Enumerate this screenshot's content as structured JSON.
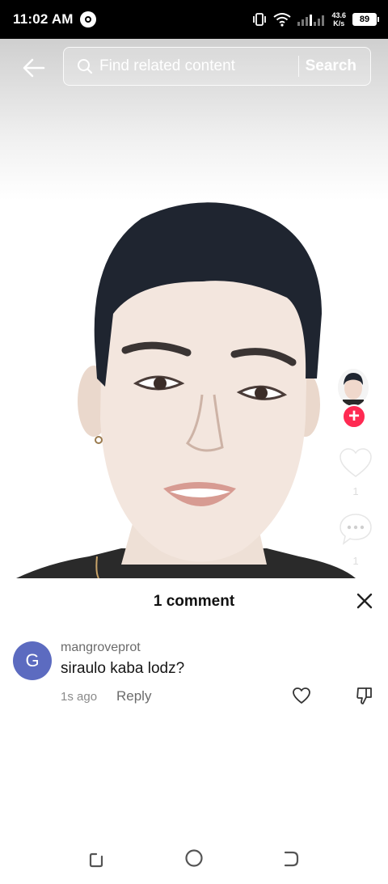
{
  "status_bar": {
    "time": "11:02 AM",
    "net_speed_value": "43.6",
    "net_speed_unit": "K/s",
    "battery": "89"
  },
  "top_bar": {
    "search_placeholder": "Find related content",
    "search_button": "Search"
  },
  "side_actions": {
    "like_count": "1",
    "comment_count": "1",
    "follow_symbol": "+"
  },
  "comments": {
    "title": "1 comment",
    "items": [
      {
        "avatar_letter": "G",
        "avatar_color": "#5c6bc0",
        "username": "mangroveprot",
        "text": "siraulo kaba lodz?",
        "time": "1s ago",
        "reply_label": "Reply"
      }
    ]
  },
  "colors": {
    "accent": "#ff2a52",
    "status_bar_bg": "#000000"
  },
  "icons": {
    "back": "arrow-left-icon",
    "search": "search-icon",
    "like": "heart-icon",
    "comment": "speech-bubble-icon",
    "close": "close-icon",
    "dislike": "thumbs-down-icon"
  }
}
